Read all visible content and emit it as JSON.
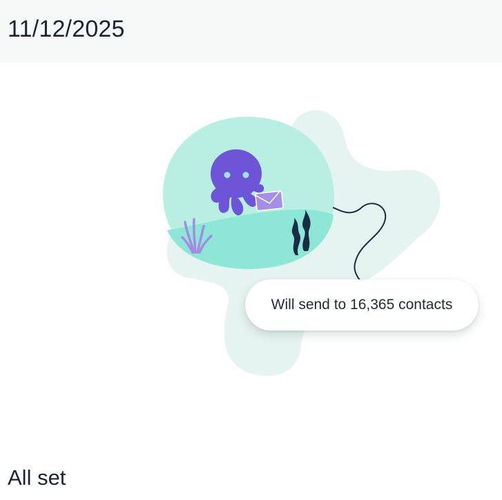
{
  "header": {
    "date": "11/12/2025"
  },
  "illustration": {
    "mascot": "octopus-icon",
    "item": "envelope-icon",
    "colors": {
      "blob_back": "#e6f4f1",
      "blob_front": "#b9efe3",
      "water": "#8ee6d6",
      "octopus": "#6e55d8",
      "envelope": "#a48ee8",
      "seaweed": "#1a2b45",
      "coral": "#a38be6",
      "string": "#1a2b45"
    }
  },
  "tooltip": {
    "text": "Will send to 16,365 contacts"
  },
  "status": {
    "text": "All set"
  }
}
